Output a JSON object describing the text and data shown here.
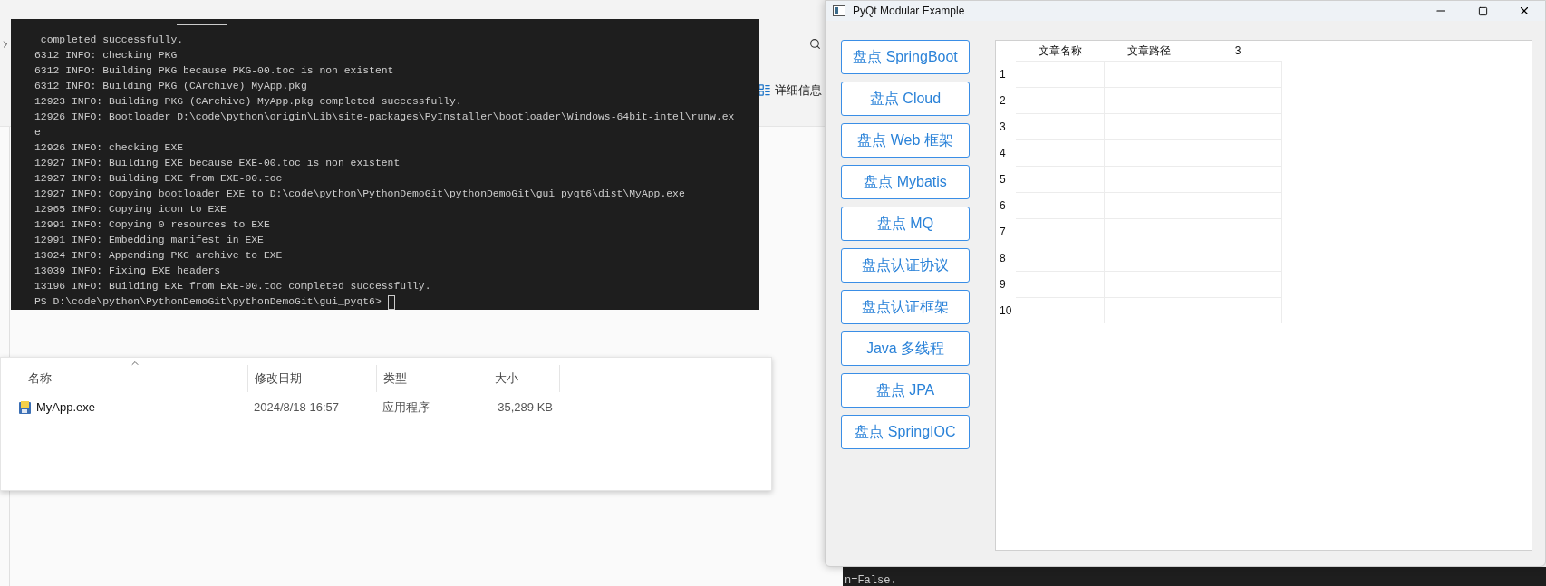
{
  "explorer": {
    "details_label": "详细信息",
    "columns": [
      "名称",
      "修改日期",
      "类型",
      "大小"
    ],
    "files": [
      {
        "name": "MyApp.exe",
        "modified": "2024/8/18 16:57",
        "type": "应用程序",
        "size": "35,289 KB"
      }
    ]
  },
  "terminal": {
    "lines": [
      " completed successfully.",
      "6312 INFO: checking PKG",
      "6312 INFO: Building PKG because PKG-00.toc is non existent",
      "6312 INFO: Building PKG (CArchive) MyApp.pkg",
      "12923 INFO: Building PKG (CArchive) MyApp.pkg completed successfully.",
      "12926 INFO: Bootloader D:\\code\\python\\origin\\Lib\\site-packages\\PyInstaller\\bootloader\\Windows-64bit-intel\\runw.ex",
      "e",
      "12926 INFO: checking EXE",
      "12927 INFO: Building EXE because EXE-00.toc is non existent",
      "12927 INFO: Building EXE from EXE-00.toc",
      "12927 INFO: Copying bootloader EXE to D:\\code\\python\\PythonDemoGit\\pythonDemoGit\\gui_pyqt6\\dist\\MyApp.exe",
      "12965 INFO: Copying icon to EXE",
      "12991 INFO: Copying 0 resources to EXE",
      "12991 INFO: Embedding manifest in EXE",
      "13024 INFO: Appending PKG archive to EXE",
      "13039 INFO: Fixing EXE headers",
      "13196 INFO: Building EXE from EXE-00.toc completed successfully."
    ],
    "prompt": "PS D:\\code\\python\\PythonDemoGit\\pythonDemoGit\\gui_pyqt6> "
  },
  "background_terminal": {
    "lines": [
      "n=False."
    ]
  },
  "window": {
    "title": "PyQt Modular Example",
    "buttons": [
      "盘点 SpringBoot",
      "盘点 Cloud",
      "盘点 Web 框架",
      "盘点 Mybatis",
      "盘点 MQ",
      "盘点认证协议",
      "盘点认证框架",
      "Java 多线程",
      "盘点 JPA",
      "盘点 SpringIOC"
    ],
    "table": {
      "columns": [
        "文章名称",
        "文章路径",
        "3"
      ],
      "rows": [
        "1",
        "2",
        "3",
        "4",
        "5",
        "6",
        "7",
        "8",
        "9",
        "10"
      ]
    }
  }
}
